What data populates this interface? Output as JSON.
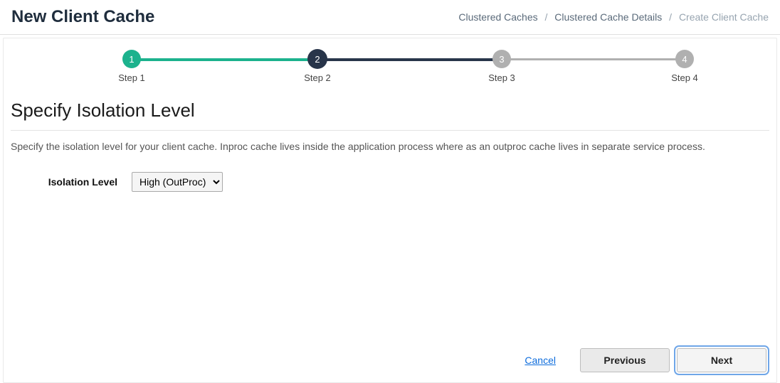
{
  "header": {
    "title": "New Client Cache"
  },
  "breadcrumbs": {
    "items": [
      {
        "label": "Clustered Caches"
      },
      {
        "label": "Clustered Cache Details"
      },
      {
        "label": "Create Client Cache",
        "current": true
      }
    ],
    "separator": "/"
  },
  "stepper": {
    "steps": [
      {
        "num": "1",
        "label": "Step 1",
        "state": "completed"
      },
      {
        "num": "2",
        "label": "Step 2",
        "state": "current"
      },
      {
        "num": "3",
        "label": "Step 3",
        "state": "future"
      },
      {
        "num": "4",
        "label": "Step 4",
        "state": "future"
      }
    ]
  },
  "section": {
    "heading": "Specify Isolation Level",
    "description": "Specify the isolation level for your client cache. Inproc cache lives inside the application process where as an outproc cache lives in separate service process."
  },
  "form": {
    "isolation_label": "Isolation Level",
    "isolation_selected": "High (OutProc)",
    "isolation_options": [
      "High (OutProc)"
    ]
  },
  "footer": {
    "cancel": "Cancel",
    "previous": "Previous",
    "next": "Next"
  }
}
